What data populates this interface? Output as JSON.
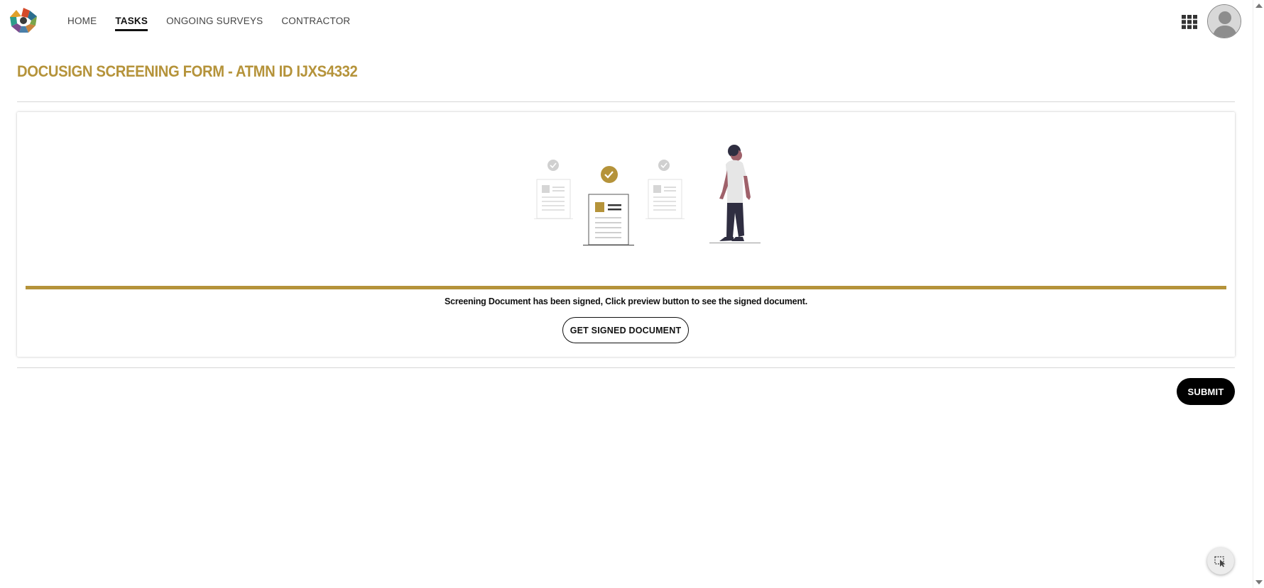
{
  "header": {
    "logo_icon": "colorful-flower-logo",
    "nav": [
      {
        "label": "HOME",
        "active": false
      },
      {
        "label": "TASKS",
        "active": true
      },
      {
        "label": "ONGOING SURVEYS",
        "active": false
      },
      {
        "label": "CONTRACTOR",
        "active": false
      }
    ],
    "apps_icon": "grid-apps-icon",
    "avatar_icon": "user-avatar-icon"
  },
  "page": {
    "title": "DOCUSIGN SCREENING FORM - ATMN ID IJXS4332"
  },
  "card": {
    "illustration": "documents-signed-illustration",
    "message": "Screening Document has been signed, Click preview button to see the signed document.",
    "signed_button_label": "GET SIGNED DOCUMENT"
  },
  "actions": {
    "submit_label": "SUBMIT"
  },
  "colors": {
    "accent": "#b5933a",
    "primary_button": "#000000"
  },
  "floating": {
    "feedback_icon": "cursor-select-icon"
  }
}
